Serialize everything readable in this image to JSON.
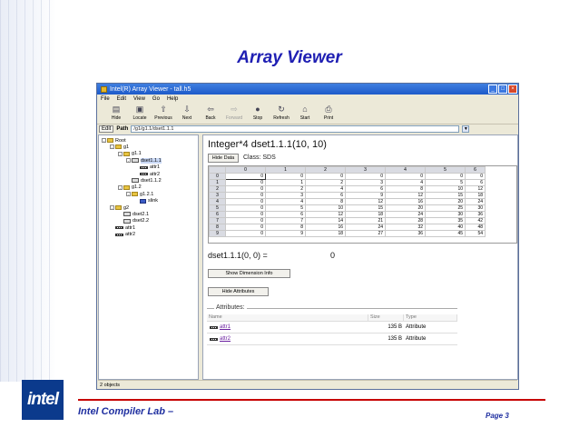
{
  "slide": {
    "title": "Array Viewer",
    "footer_left": "Intel Compiler Lab –",
    "footer_right": "Page 3",
    "logo": "intel"
  },
  "window": {
    "title": "Intel(R) Array Viewer - tall.h5",
    "buttons": [
      "_",
      "□",
      "×"
    ]
  },
  "menu": [
    "File",
    "Edit",
    "View",
    "Go",
    "Help"
  ],
  "toolbar": [
    {
      "label": "Hide",
      "icon": "hide-icon",
      "glyph": "▤",
      "enabled": true
    },
    {
      "label": "Locate",
      "icon": "locate-icon",
      "glyph": "▣",
      "enabled": true
    },
    {
      "label": "Previous",
      "icon": "previous-icon",
      "glyph": "⇧",
      "enabled": true
    },
    {
      "label": "Next",
      "icon": "next-icon",
      "glyph": "⇩",
      "enabled": true
    },
    {
      "label": "Back",
      "icon": "back-icon",
      "glyph": "⇦",
      "enabled": true
    },
    {
      "label": "Forward",
      "icon": "forward-icon",
      "glyph": "⇨",
      "enabled": false
    },
    {
      "label": "Stop",
      "icon": "stop-icon",
      "glyph": "●",
      "enabled": true
    },
    {
      "label": "Refresh",
      "icon": "refresh-icon",
      "glyph": "↻",
      "enabled": true
    },
    {
      "label": "Start",
      "icon": "start-icon",
      "glyph": "⌂",
      "enabled": true
    },
    {
      "label": "Print",
      "icon": "print-icon",
      "glyph": "⎙",
      "enabled": true
    }
  ],
  "pathbar": {
    "edit_label": "Edit",
    "path_label": "Path",
    "path_value": "/g1/g1.1/dset1.1.1"
  },
  "tree": [
    {
      "label": "Root",
      "kind": "folder",
      "indent": 0,
      "toggle": "-"
    },
    {
      "label": "g1",
      "kind": "folder",
      "indent": 1,
      "toggle": "-"
    },
    {
      "label": "g1.1",
      "kind": "folder",
      "indent": 2,
      "toggle": "-"
    },
    {
      "label": "dset1.1.1",
      "kind": "dataset",
      "indent": 3,
      "toggle": "-",
      "selected": true
    },
    {
      "label": "attr1",
      "kind": "attribute",
      "indent": 4,
      "toggle": ""
    },
    {
      "label": "attr2",
      "kind": "attribute",
      "indent": 4,
      "toggle": ""
    },
    {
      "label": "dset1.1.2",
      "kind": "dataset",
      "indent": 3,
      "toggle": ""
    },
    {
      "label": "g1.2",
      "kind": "folder",
      "indent": 2,
      "toggle": "-"
    },
    {
      "label": "g1.2.1",
      "kind": "folder",
      "indent": 3,
      "toggle": "-"
    },
    {
      "label": "slink",
      "kind": "link",
      "indent": 4,
      "toggle": ""
    },
    {
      "label": "g2",
      "kind": "folder",
      "indent": 1,
      "toggle": "-"
    },
    {
      "label": "dset2.1",
      "kind": "dataset",
      "indent": 2,
      "toggle": ""
    },
    {
      "label": "dset2.2",
      "kind": "dataset",
      "indent": 2,
      "toggle": ""
    },
    {
      "label": "attr1",
      "kind": "attribute",
      "indent": 1,
      "toggle": ""
    },
    {
      "label": "attr2",
      "kind": "attribute",
      "indent": 1,
      "toggle": ""
    }
  ],
  "dataset": {
    "title": "Integer*4 dset1.1.1(10, 10)",
    "hide_data_label": "Hide Data",
    "class_label": "Class:  SDS",
    "columns": [
      "",
      "0",
      "1",
      "2",
      "3",
      "4",
      "5",
      "6"
    ],
    "rows": [
      [
        "0",
        "0",
        "0",
        "0",
        "0",
        "0",
        "0",
        "0"
      ],
      [
        "1",
        "0",
        "1",
        "2",
        "3",
        "4",
        "5",
        "6"
      ],
      [
        "2",
        "0",
        "2",
        "4",
        "6",
        "8",
        "10",
        "12"
      ],
      [
        "3",
        "0",
        "3",
        "6",
        "9",
        "12",
        "15",
        "18"
      ],
      [
        "4",
        "0",
        "4",
        "8",
        "12",
        "16",
        "20",
        "24"
      ],
      [
        "5",
        "0",
        "5",
        "10",
        "15",
        "20",
        "25",
        "30"
      ],
      [
        "6",
        "0",
        "6",
        "12",
        "18",
        "24",
        "30",
        "36"
      ],
      [
        "7",
        "0",
        "7",
        "14",
        "21",
        "28",
        "35",
        "42"
      ],
      [
        "8",
        "0",
        "8",
        "16",
        "24",
        "32",
        "40",
        "48"
      ],
      [
        "9",
        "0",
        "9",
        "18",
        "27",
        "36",
        "45",
        "54"
      ]
    ],
    "cell_readout": "dset1.1.1(0, 0) =",
    "cell_value": "0",
    "show_dimension_label": "Show Dimension Info",
    "hide_attributes_label": "Hide Attributes"
  },
  "attributes": {
    "group_label": "Attributes:",
    "headers": [
      "Name",
      "Size",
      "Type"
    ],
    "rows": [
      {
        "name": "attr1",
        "size": "135 B",
        "type": "Attribute"
      },
      {
        "name": "attr2",
        "size": "135 B",
        "type": "Attribute"
      }
    ]
  },
  "status": "2 objects"
}
